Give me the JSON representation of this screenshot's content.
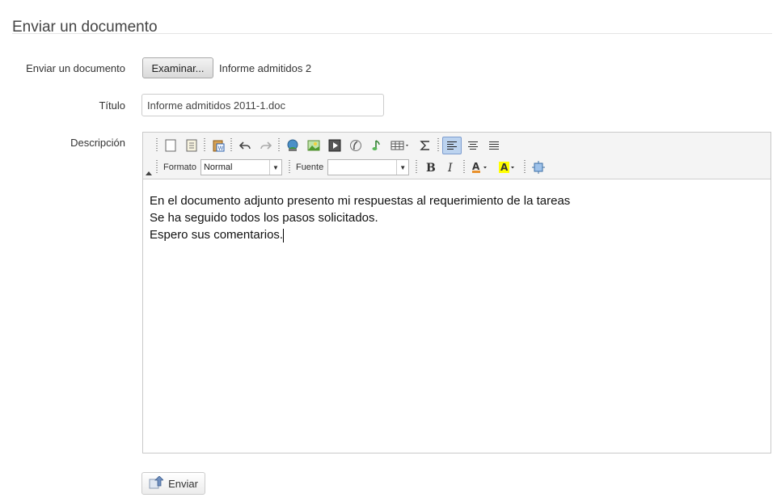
{
  "page": {
    "title": "Enviar un documento"
  },
  "form": {
    "document_label": "Enviar un documento",
    "browse_label": "Examinar...",
    "file_name": "Informe admitidos 2",
    "title_label": "Título",
    "title_value": "Informe admitidos 2011-1.doc",
    "description_label": "Descripción",
    "submit_label": "Enviar"
  },
  "editor": {
    "format_label": "Formato",
    "format_value": "Normal",
    "font_label": "Fuente",
    "font_value": "",
    "lines": [
      "En el documento adjunto presento mi respuestas al requerimiento de la tareas",
      "Se ha seguido todos los pasos solicitados.",
      "Espero sus comentarios."
    ],
    "toolbar_row1_icons": [
      "new-page-icon",
      "templates-icon",
      "paste-word-icon",
      "undo-icon",
      "redo-icon",
      "link-icon",
      "image-icon",
      "video-icon",
      "flash-icon",
      "audio-icon",
      "table-icon",
      "sigma-icon",
      "align-left-icon",
      "align-center-icon",
      "align-justify-icon"
    ],
    "toolbar_row2_icons": [
      "bold-icon",
      "italic-icon",
      "text-color-icon",
      "highlight-color-icon",
      "fullscreen-icon"
    ]
  },
  "colors": {
    "accent": "#7c9ccf",
    "active_bg": "#bcd3ef",
    "highlight": "#ffff00"
  }
}
